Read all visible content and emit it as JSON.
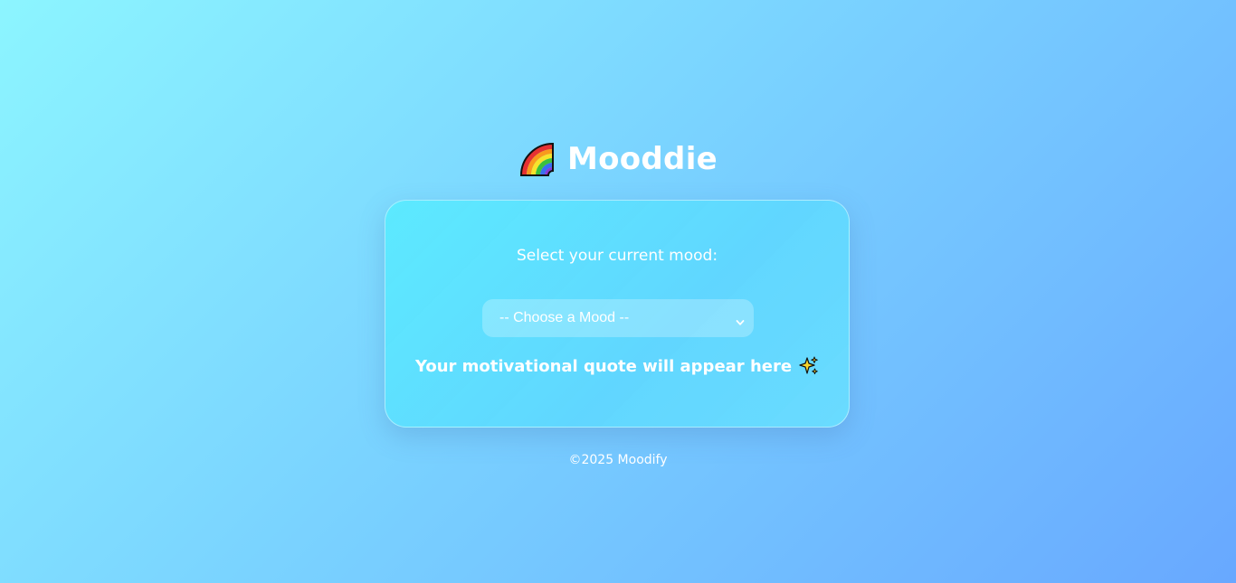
{
  "app": {
    "title": "Mooddie",
    "logo_icon": "rainbow-icon"
  },
  "card": {
    "prompt": "Select your current mood:",
    "mood_select": {
      "selected": "-- Choose a Mood --",
      "icon": "chevron-down-icon"
    },
    "quote_placeholder": "Your motivational quote will appear here",
    "quote_icon": "sparkles-icon"
  },
  "footer": {
    "text": "©2025 Moodify"
  },
  "colors": {
    "background_start": "#8cf5ff",
    "background_end": "#68a8ff",
    "card": "#5ae0ff",
    "text": "#ffffff"
  }
}
